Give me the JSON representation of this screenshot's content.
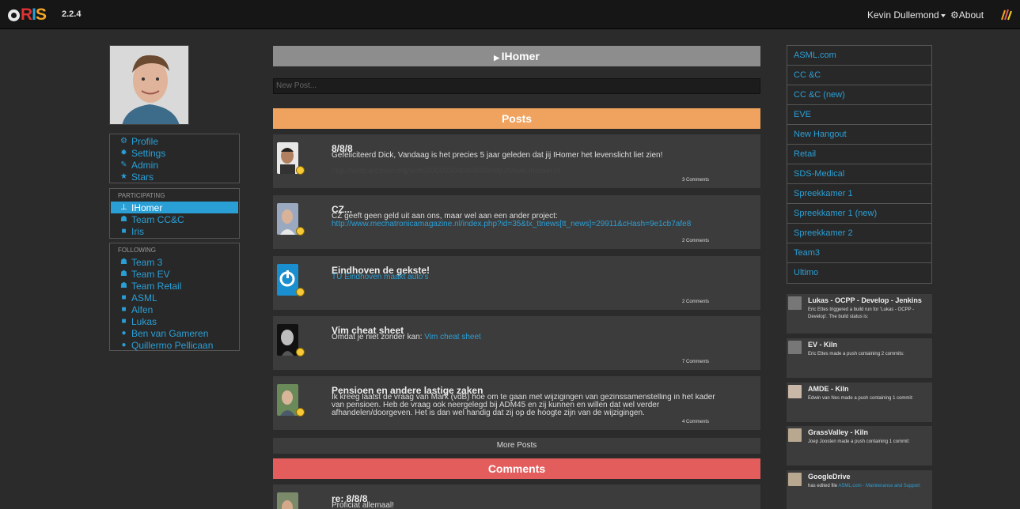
{
  "navbar": {
    "version": "2.2.4",
    "user": "Kevin Dullemond",
    "about": "About"
  },
  "sidebar": {
    "menu": [
      {
        "label": "Profile",
        "icon": "gears-icon"
      },
      {
        "label": "Settings",
        "icon": "gear-icon"
      },
      {
        "label": "Admin",
        "icon": "wrench-icon"
      },
      {
        "label": "Stars",
        "icon": "star-icon"
      }
    ],
    "participating_header": "PARTICIPATING",
    "participating": [
      {
        "label": "IHomer",
        "icon": "sitemap-icon",
        "active": true
      },
      {
        "label": "Team CC&C",
        "icon": "group-icon"
      },
      {
        "label": "Iris",
        "icon": "briefcase-icon"
      }
    ],
    "following_header": "FOLLOWING",
    "following": [
      {
        "label": "Team 3",
        "icon": "group-icon"
      },
      {
        "label": "Team EV",
        "icon": "group-icon"
      },
      {
        "label": "Team Retail",
        "icon": "group-icon"
      },
      {
        "label": "ASML",
        "icon": "briefcase-icon"
      },
      {
        "label": "Alfen",
        "icon": "briefcase-icon"
      },
      {
        "label": "Lukas",
        "icon": "briefcase-icon"
      },
      {
        "label": "Ben van Gameren",
        "icon": "user-icon"
      },
      {
        "label": "Quillermo Pellicaan",
        "icon": "user-icon"
      }
    ]
  },
  "main": {
    "title": "IHomer",
    "new_post_placeholder": "New Post...",
    "posts_header": "Posts",
    "comments_header": "Comments",
    "more_posts": "More Posts",
    "posts": [
      {
        "title": "8/8/8",
        "text": "Gefeliciteerd Dick, Vandaag is het precies 5 jaar geleden dat jij IHomer het levenslicht liet zien!",
        "link": "http://web.archive.org/web/20090504080609/http://www.ihomer.nl",
        "comments": "3 Comments"
      },
      {
        "title": "CZ...",
        "text": "CZ geeft geen geld uit aan ons, maar wel aan een ander project:",
        "link": "http://www.mechatronicamagazine.nl/index.php?id=35&tx_ttnews[tt_news]=29911&cHash=9e1cb7afe8",
        "comments": "2 Comments"
      },
      {
        "title": "Eindhoven de gekste!",
        "text": "",
        "link": "TU Eindhoven maakt auto's",
        "comments": "2 Comments"
      },
      {
        "title": "Vim cheat sheet",
        "text": "Omdat je niet zonder kan: ",
        "link": "Vim cheat sheet",
        "comments": "7 Comments"
      },
      {
        "title": "Pensioen en andere lastige zaken",
        "text": "Ik kreeg laatst de vraag van Mark (vdB) hoe om te gaan met wijzigingen van gezinssamenstelling in het kader van pensioen. Heb de vraag ook neergelegd bij ADM45 en zij kunnen en willen dat wel verder afhandelen/doorgeven. Het is dan wel handig dat zij op de hoogte zijn van de wijzigingen.",
        "link": "",
        "comments": "4 Comments"
      }
    ],
    "comment": {
      "title": "re: 8/8/8",
      "text": "Proficiat allemaal!"
    }
  },
  "rightbar": {
    "links": [
      "ASML.com",
      "CC &C",
      "CC &C (new)",
      "EVE",
      "New Hangout",
      "Retail",
      "SDS-Medical",
      "Spreekkamer 1",
      "Spreekkamer 1 (new)",
      "Spreekkamer 2",
      "Team3",
      "Ultimo"
    ],
    "activities": [
      {
        "title": "Lukas - OCPP - Develop - Jenkins",
        "text": "Eric Ettes triggered a build run for 'Lukas - OCPP - Develop'. The build status is:"
      },
      {
        "title": "EV - Kiln",
        "text": "Eric Ettes made a push containing 2 commits:"
      },
      {
        "title": "AMDE - Kiln",
        "text": "Edwin van Nes made a push containing 1 commit:"
      },
      {
        "title": "GrassValley - Kiln",
        "text": "Joep Joosten made a push containing 1 commit:"
      },
      {
        "title": "GoogleDrive",
        "text": "has edited file ",
        "link": "ASML.com - Maintenance and Support"
      }
    ]
  }
}
